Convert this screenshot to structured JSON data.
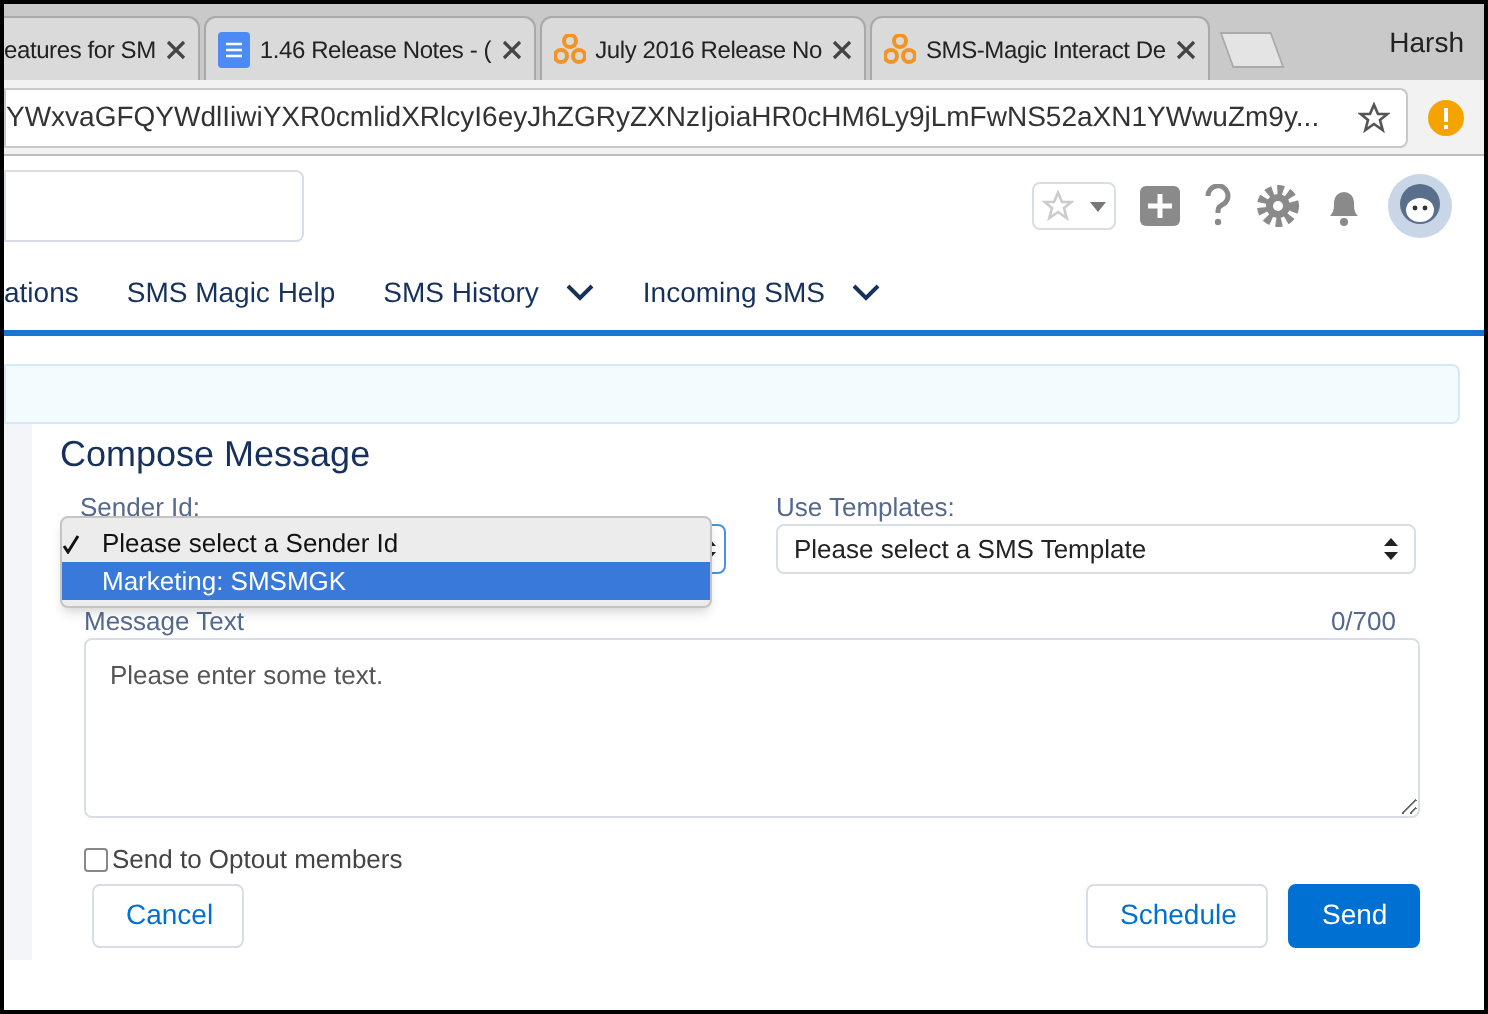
{
  "browser": {
    "tabs": [
      {
        "title": "eatures for SM",
        "kind": "plain"
      },
      {
        "title": "1.46 Release Notes - (",
        "kind": "doc"
      },
      {
        "title": "July 2016 Release No",
        "kind": "logo"
      },
      {
        "title": "SMS-Magic Interact De",
        "kind": "logo"
      }
    ],
    "profile": "Harsh",
    "address": "YWxvaGFQYWdlIiwiYXR0cmlidXRlcyI6eyJhZGRyZXNzIjoiaHR0cHM6Ly9jLmFwNS52aXN1YWwuZm9y..."
  },
  "nav": [
    {
      "label": "ations",
      "has_menu": false
    },
    {
      "label": "SMS Magic Help",
      "has_menu": false
    },
    {
      "label": "SMS History",
      "has_menu": true
    },
    {
      "label": "Incoming SMS",
      "has_menu": true
    }
  ],
  "form": {
    "title": "Compose Message",
    "sender_label": "Sender Id:",
    "template_label": "Use Templates:",
    "template_value": "Please select a SMS Template",
    "sender_options": [
      {
        "label": "Please select a Sender Id",
        "checked": true,
        "highlighted": false
      },
      {
        "label": "Marketing: SMSMGK",
        "checked": false,
        "highlighted": true
      }
    ],
    "message_label": "Message Text",
    "counter": "0/700",
    "message_placeholder": "Please enter some text.",
    "optout": {
      "label": "Send to Optout members",
      "checked": false
    },
    "buttons": [
      {
        "label": "Cancel",
        "kind": "outline"
      },
      {
        "label": "Schedule",
        "kind": "outline"
      },
      {
        "label": "Send",
        "kind": "primary"
      }
    ]
  }
}
